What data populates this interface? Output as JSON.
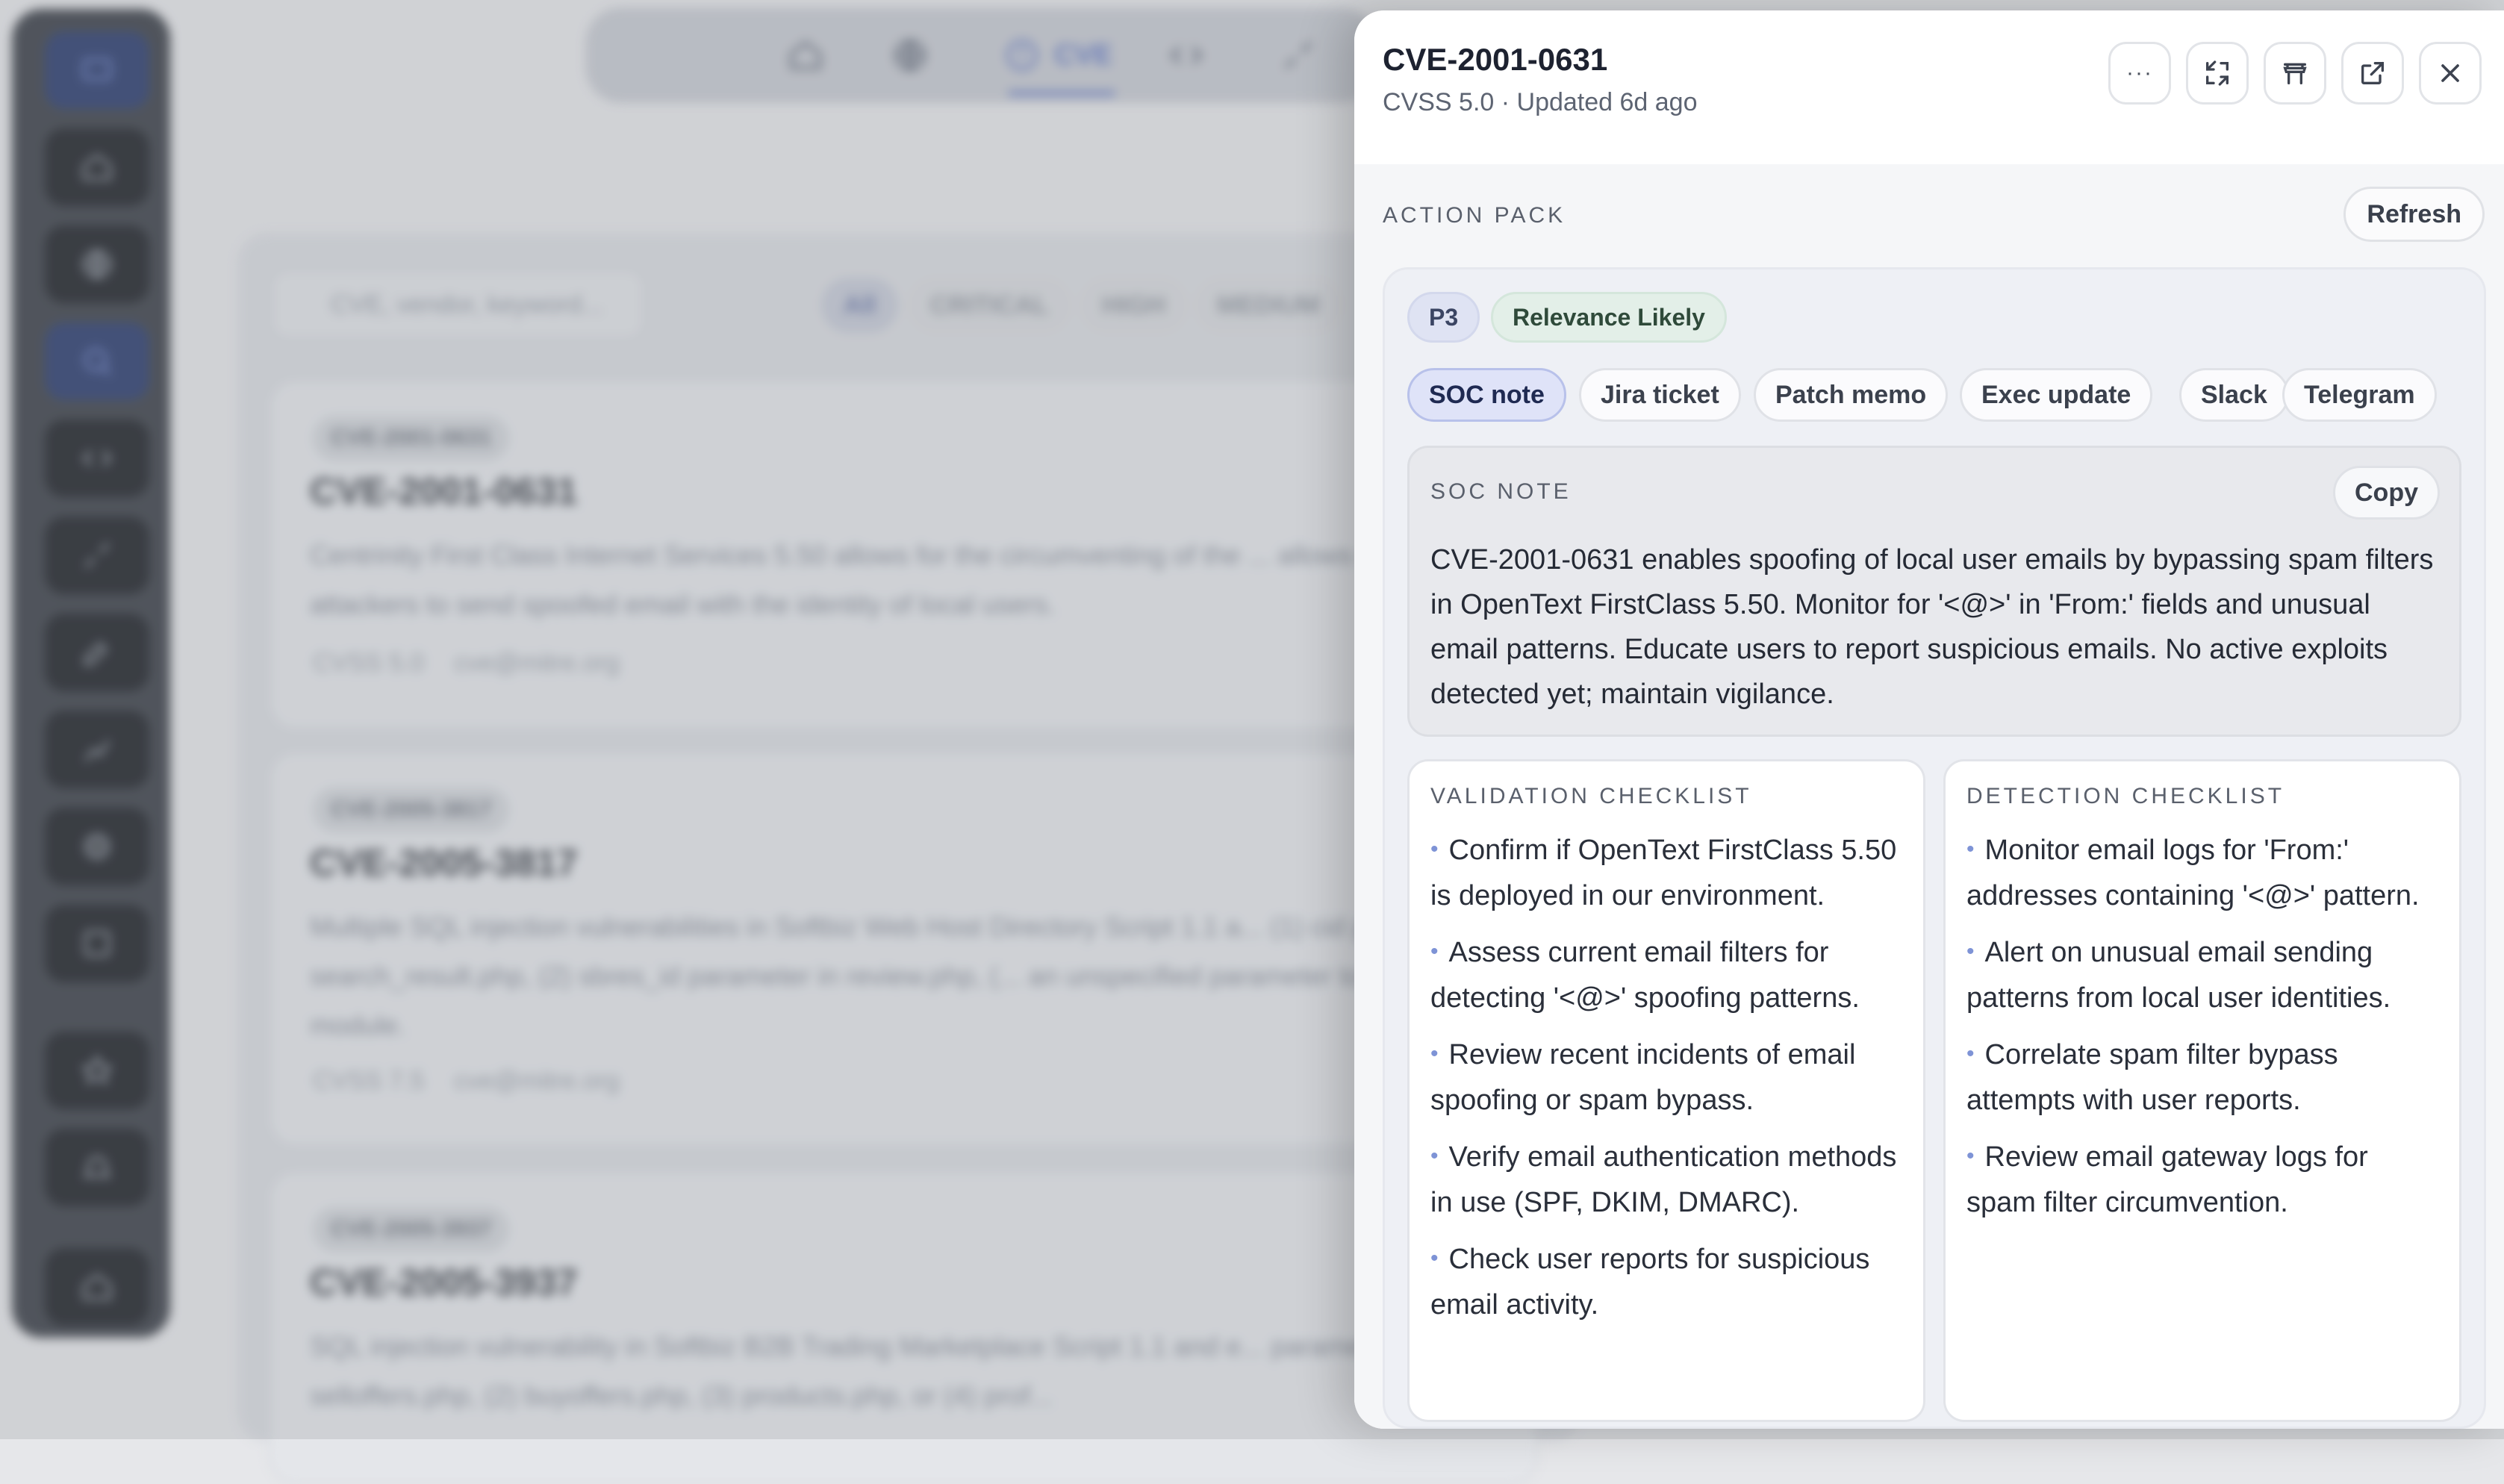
{
  "background": {
    "nav": [
      {
        "label": ""
      },
      {
        "label": ""
      },
      {
        "label": "CVE"
      },
      {
        "label": ""
      },
      {
        "label": ""
      }
    ],
    "search_placeholder": "CVE, vendor, keyword...",
    "filters": [
      "All",
      "CRITICAL",
      "HIGH",
      "MEDIUM"
    ],
    "cards": [
      {
        "id": "CVE-2001-0631",
        "title": "CVE-2001-0631",
        "desc": "Centrinity First Class Internet Services 5.50 allows for the circumventing of the ... allows remote attackers to send spoofed email with the identity of local users.",
        "cvss": "CVSS 5.0",
        "source": "cve@mitre.org"
      },
      {
        "id": "CVE-2005-3817",
        "title": "CVE-2005-3817",
        "desc": "Multiple SQL injection vulnerabilities in Softbiz Web Host Directory Script 1.1 a... (1) cid parameter in search_result.php, (2) sbres_id parameter in review.php, (... an unspecified parameter to the search module.",
        "cvss": "CVSS 7.5",
        "source": "cve@mitre.org"
      },
      {
        "id": "CVE-2005-3937",
        "title": "CVE-2005-3937",
        "desc": "SQL injection vulnerability in Softbiz B2B Trading Marketplace Script 1.1 and e... parameter in (1) selloffers.php, (2) buyoffers.php, (3) products.php, or (4) prof...",
        "cvss": "",
        "source": ""
      }
    ]
  },
  "drawer": {
    "title": "CVE-2001-0631",
    "subtitle": "CVSS 5.0 · Updated 6d ago",
    "more_icon": "···",
    "section_label": "ACTION PACK",
    "refresh_label": "Refresh",
    "priority": "P3",
    "relevance": "Relevance Likely",
    "tabs": [
      "SOC note",
      "Jira ticket",
      "Patch memo",
      "Exec update",
      "Slack",
      "Telegram"
    ],
    "note_label": "SOC NOTE",
    "copy_label": "Copy",
    "note_text": "CVE-2001-0631 enables spoofing of local user emails by bypassing spam filters in OpenText FirstClass 5.50. Monitor for '<@>' in 'From:' fields and unusual email patterns. Educate users to report suspicious emails. No active exploits detected yet; maintain vigilance.",
    "validation_label": "VALIDATION CHECKLIST",
    "validation_items": [
      "Confirm if OpenText FirstClass 5.50 is deployed in our environment.",
      "Assess current email filters for detecting '<@>' spoofing patterns.",
      "Review recent incidents of email spoofing or spam bypass.",
      "Verify email authentication methods in use (SPF, DKIM, DMARC).",
      "Check user reports for suspicious email activity."
    ],
    "detection_label": "DETECTION CHECKLIST",
    "detection_items": [
      "Monitor email logs for 'From:' addresses containing '<@>' pattern.",
      "Alert on unusual email sending patterns from local user identities.",
      "Correlate spam filter bypass attempts with user reports.",
      "Review email gateway logs for spam filter circumvention."
    ]
  },
  "colors": {
    "accent": "#6c80c7",
    "active_tab_bg": "#dfe3f8",
    "relevance_bg": "#e3efe8"
  }
}
